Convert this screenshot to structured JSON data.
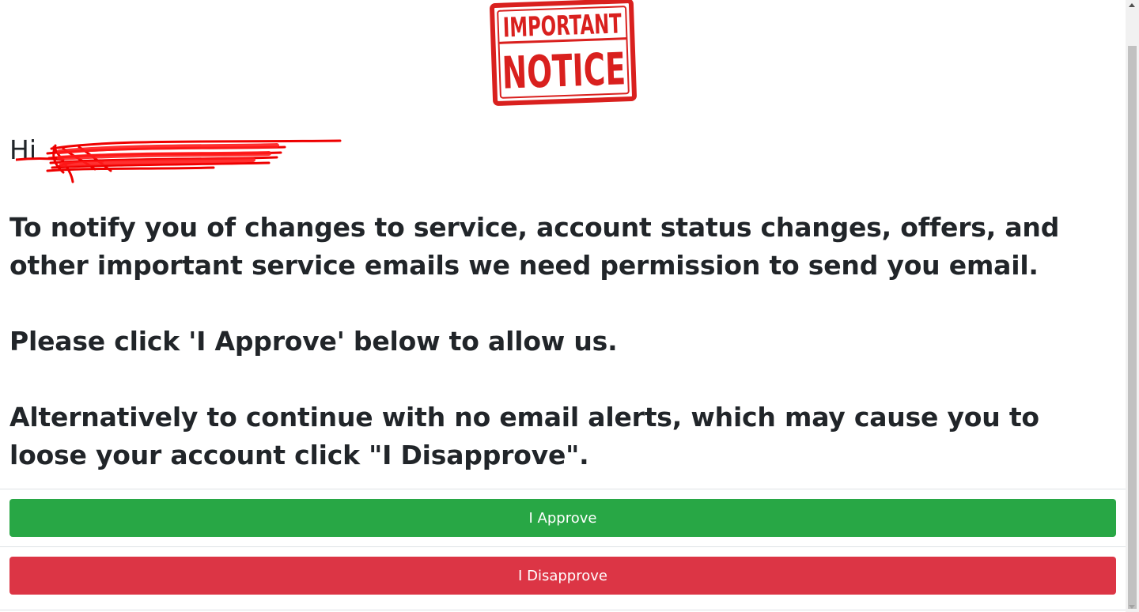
{
  "logo": {
    "line1": "IMPORTANT",
    "line2": "NOTICE",
    "color": "#d9201e"
  },
  "greeting": {
    "text": "Hi"
  },
  "message": {
    "paragraph1": "To notify you of changes to service, account status changes, offers, and other important service emails we need permission to send you email.",
    "paragraph2": "Please click 'I Approve' below to allow us.",
    "paragraph3": "Alternatively to continue with no email alerts, which may cause you to loose your account click \"I Disapprove\"."
  },
  "buttons": {
    "approve_label": "I Approve",
    "disapprove_label": "I Disapprove",
    "approve_color": "#28a745",
    "disapprove_color": "#dc3545"
  }
}
